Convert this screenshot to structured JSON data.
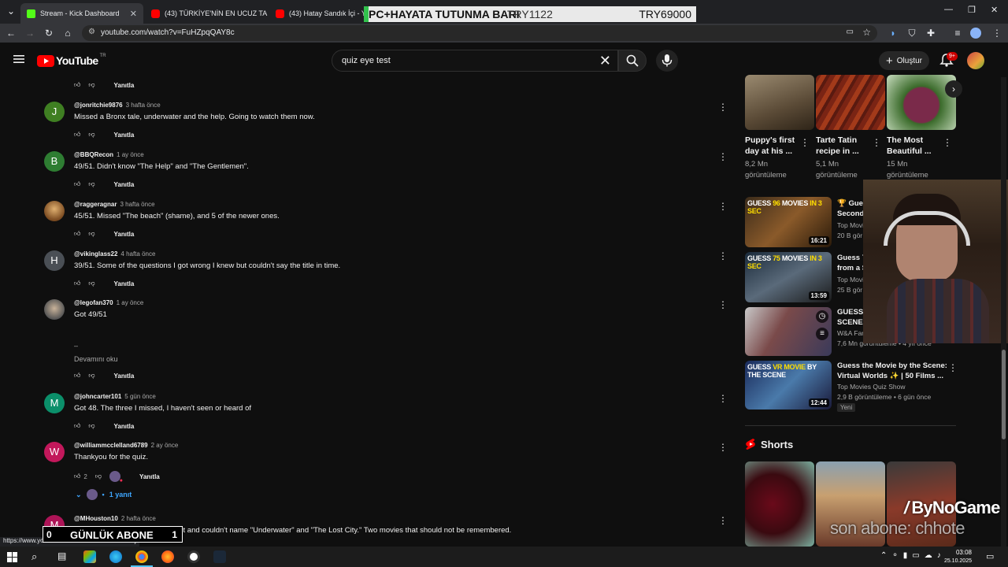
{
  "browser": {
    "tabs": [
      {
        "title": "Stream - Kick Dashboard",
        "color": "#53fc18"
      },
      {
        "title": "(43) TÜRKİYE'NİN EN UCUZ TA",
        "color": "#ff0000"
      },
      {
        "title": "(43) Hatay Sandık İçi - YouT",
        "color": "#ff0000"
      }
    ],
    "url": "youtube.com/watch?v=FuHZpqQAY8c"
  },
  "overlay": {
    "banner_left": "PC+HAYATA TUTUNMA BARI",
    "banner_mid": "TRY1122",
    "banner_right": "TRY69000",
    "sub_counter_value": "0",
    "sub_counter_label": "GÜNLÜK ABONE",
    "sub_counter_goal": "1",
    "brand": "ByNoGame",
    "caption": "son abone: chhote"
  },
  "header": {
    "logo_text": "YouTube",
    "logo_region": "TR",
    "search_query": "quiz eye test",
    "create_label": "Oluştur",
    "notif_badge": "9+"
  },
  "comments": {
    "reply_label": "Yanıtla",
    "top_reply_label": "Yanıtla",
    "items": [
      {
        "initial": "J",
        "color": "#3f7f22",
        "user": "@jonritchie9876",
        "time": "3 hafta önce",
        "text": "Missed a Bronx tale, underwater and the help. Going to watch them now."
      },
      {
        "initial": "B",
        "color": "#2e7d32",
        "user": "@BBQRecon",
        "time": "1 ay önce",
        "text": "49/51. Didn't know \"The Help\" and \"The Gentlemen\"."
      },
      {
        "initial": "",
        "color": "#8d5b2c",
        "user": "@raggeragnar",
        "time": "3 hafta önce",
        "text": "45/51. Missed \"The beach\" (shame), and 5 of the newer ones."
      },
      {
        "initial": "H",
        "color": "#4a4f55",
        "user": "@vikinglass22",
        "time": "4 hafta önce",
        "text": "39/51. Some of the questions I got wrong I knew but couldn't say the title in time."
      },
      {
        "initial": "",
        "color": "#5a5a5a",
        "user": "@legofan370",
        "time": "1 ay önce",
        "text": "Got 49/51"
      },
      {
        "initial": "M",
        "color": "#0b8f6a",
        "user": "@johncarter101",
        "time": "5 gün önce",
        "text": "Got 48. The three I missed, I haven't seen or heard of"
      },
      {
        "initial": "W",
        "color": "#c2185b",
        "user": "@williammcclelland6789",
        "time": "2 ay önce",
        "text": "Thankyou for the quiz."
      },
      {
        "initial": "M",
        "color": "#ad1457",
        "user": "@MHouston10",
        "time": "2 hafta önce",
        "text": "Correct and couldn't name \"Underwater\" and \"The Lost City.\" Two movies that should not be remembered."
      }
    ],
    "dash": "–",
    "read_more": "Devamını oku",
    "like_count_w": "2",
    "replies_label": "1 yanıt"
  },
  "sidebar": {
    "top_row": [
      {
        "title_l1": "Puppy's first",
        "title_l2": "day at his ...",
        "views": "8,2 Mn",
        "views_l2": "görüntüleme"
      },
      {
        "title_l1": "Tarte Tatin",
        "title_l2": "recipe in ...",
        "views": "5,1 Mn",
        "views_l2": "görüntüleme"
      },
      {
        "title_l1": "The Most",
        "title_l2": "Beautiful ...",
        "views": "15 Mn",
        "views_l2": "görüntüleme"
      }
    ],
    "videos": [
      {
        "thumb_text_a": "GUESS ",
        "thumb_text_b": "96",
        "thumb_text_c": " MOVIES ",
        "thumb_text_d": "IN 3 SEC",
        "title_l1": "🏆 Gues",
        "title_l2": "Second",
        "channel": "Top Movi",
        "meta": "20 B gör",
        "duration": "16:21"
      },
      {
        "thumb_text_a": "GUESS ",
        "thumb_text_b": "75",
        "thumb_text_c": " MOVIES ",
        "thumb_text_d": "IN 3 SEC",
        "title_l1": "Guess 7",
        "title_l2": "from a S",
        "channel": "Top Movi",
        "meta": "25 B gör",
        "duration": "13:59"
      },
      {
        "thumb_text_a": "",
        "thumb_text_b": "",
        "thumb_text_c": "",
        "thumb_text_d": "",
        "title_l1": "GUESS T",
        "title_l2": "SCENE (",
        "channel": "W&A Family",
        "meta": "7,6 Mn görüntüleme • 4 yıl önce",
        "duration": ""
      },
      {
        "thumb_text_a": "GUESS ",
        "thumb_text_b": "VR MOVIE",
        "thumb_text_c": " BY THE SCENE",
        "thumb_text_d": "",
        "title_l1": "Guess the Movie by the Scene:",
        "title_l2": "Virtual Worlds ✨ | 50 Films ...",
        "channel": "Top Movies Quiz Show",
        "meta": "2,9 B görüntüleme • 6 gün önce",
        "duration": "12:44",
        "badge": "Yeni"
      }
    ],
    "shorts_label": "Shorts"
  },
  "status_url": "https://www.youtube.com/watch?v=bl 5D9vPFbj",
  "taskbar": {
    "time": "03:08",
    "date": "25.10.2025"
  }
}
